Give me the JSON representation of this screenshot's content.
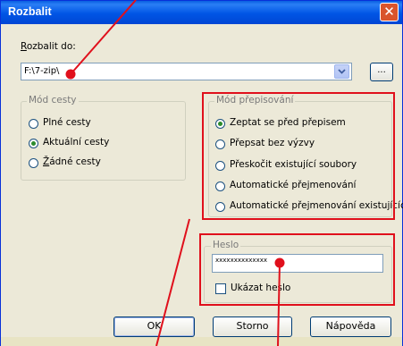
{
  "window": {
    "title": "Rozbalit",
    "close_symbol": "✕"
  },
  "extract_to": {
    "label": "Rozbalit do:",
    "label_accesskey": "R",
    "label_rest": "ozbalit do:",
    "path_value": "F:\\7-zip\\",
    "browse_label": "..."
  },
  "path_mode": {
    "legend": "Mód cesty",
    "options": [
      {
        "label": "Plné cesty",
        "selected": false
      },
      {
        "label": "Aktuální cesty",
        "selected": true
      },
      {
        "label_accesskey": "Ž",
        "label_rest": "ádné cesty",
        "selected": false
      }
    ]
  },
  "overwrite_mode": {
    "legend": "Mód přepisování",
    "options": [
      {
        "label": "Zeptat se před přepisem",
        "selected": true
      },
      {
        "label": "Přepsat bez výzvy",
        "selected": false
      },
      {
        "label": "Přeskočit existující soubory",
        "selected": false
      },
      {
        "label": "Automatické přejmenování",
        "selected": false
      },
      {
        "label": "Automatické přejmenování existujícíc",
        "selected": false
      }
    ]
  },
  "password": {
    "legend": "Heslo",
    "value": "xxxxxxxxxxxxxx",
    "show_label": "Ukázat heslo",
    "show_checked": false
  },
  "buttons": {
    "ok": "OK",
    "cancel": "Storno",
    "help": "Nápověda"
  },
  "colors": {
    "highlight": "#e0101c",
    "title_bar": "#0055e5",
    "dialog": "#ece9d8"
  }
}
